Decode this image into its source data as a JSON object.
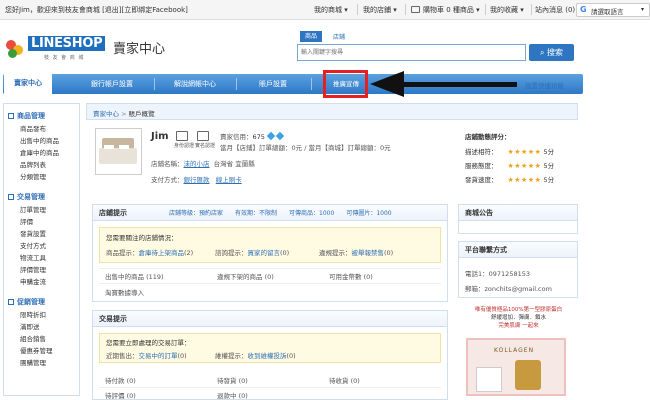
{
  "topbar": {
    "greeting": "您好Jim，歡迎來到枝友會商城",
    "logout": "[退出]",
    "bind_fb": "[立即綁定Facebook]",
    "my_mall": "我的商城",
    "my_store": "我的店鋪",
    "cart": "購物車 0 種商品",
    "favorites": "我的收藏",
    "site_msg": "站內消息 (0)",
    "translate": "請選取語言"
  },
  "brand": {
    "logo": "LINESHOP",
    "logo_sub": "枝 友 會 商 城",
    "page_title": "賣家中心",
    "accent": "#2f76c2"
  },
  "search": {
    "tab_products": "商品",
    "tab_stores": "店鋪",
    "placeholder": "輸入關鍵字搜尋",
    "button": "搜索"
  },
  "nav": {
    "items": [
      "賣家中心",
      "銀行帳戶設置",
      "解說網帳中心",
      "賬戶設置",
      "推廣宣傳"
    ],
    "shortcut": "設置快捷功能",
    "highlight_color": "#e52020"
  },
  "sidebar": {
    "groups": [
      {
        "title": "商品管理",
        "items": [
          "商品發布",
          "出售中的商品",
          "倉庫中的商品",
          "品牌列表",
          "分類管理"
        ]
      },
      {
        "title": "交易管理",
        "items": [
          "訂單管理",
          "評價",
          "發貨設置",
          "支付方式",
          "物流工具",
          "評價管理",
          "申購金流"
        ]
      },
      {
        "title": "促銷管理",
        "items": [
          "限時折扣",
          "滿即送",
          "組合銷售",
          "優惠券管理",
          "團購管理"
        ]
      }
    ]
  },
  "breadcrumb": {
    "home": "賣家中心",
    "sep": ">",
    "current": "賬戶概覽"
  },
  "profile": {
    "name": "Jim",
    "icon1": "身份認證",
    "icon2": "實名認證",
    "seller_credit_label": "賣家信用：",
    "seller_credit": "675",
    "month_label": "當月【店鋪】訂單總額：0元 / 當月【商城】訂單總額：0元",
    "store_label": "店鋪名稱：",
    "store_name": "沫的小店",
    "region": "台灣省 宜蘭縣",
    "pay_label": "支付方式：",
    "pay1": "銀行匯款",
    "pay2": "線上刷卡"
  },
  "ratings": {
    "title": "店鋪動態評分：",
    "rows": [
      {
        "label": "描述相符：",
        "stars": "★★★★★",
        "score": "5分"
      },
      {
        "label": "服務態度：",
        "stars": "★★★★★",
        "score": "5分"
      },
      {
        "label": "發貨速度：",
        "stars": "★★★★★",
        "score": "5分"
      }
    ]
  },
  "store_tips": {
    "title": "店鋪提示",
    "level": "店鋪等級：預約店家",
    "valid": "有效期：不限制",
    "products": "可傳商品：1000",
    "images": "可傳圖片：1000",
    "notice_title": "您需要關注的店鋪情況：",
    "product_tip_label": "商品提示：",
    "product_tip": "倉庫待上架商品",
    "product_tip_count": "(2)",
    "consult_label": "諮詢提示：",
    "consult": "買家的留言",
    "consult_count": "(0)",
    "violate_label": "違規提示：",
    "violate": "被舉報禁售",
    "violate_count": "(0)",
    "row1": [
      "出售中的商品 (119)",
      "違規下架的商品 (0)",
      "可用金幣數 (0)"
    ],
    "row2": "淘寶數據導入"
  },
  "trade_tips": {
    "title": "交易提示",
    "notice_title": "您需要立即處理的交易訂單：",
    "recent_label": "近期售出：",
    "recent": "交易中的訂單",
    "recent_count": "(0)",
    "refund_label": "維權提示：",
    "refund": "收到維權投訴",
    "refund_count": "(0)",
    "row1": [
      "待付款 (0)",
      "待發貨 (0)",
      "待收貨 (0)"
    ],
    "row2": [
      "待評價 (0)",
      "退款中 (0)"
    ]
  },
  "announce": {
    "title": "商城公告"
  },
  "contact": {
    "title": "平台聯繫方式",
    "phone_label": "電話1：",
    "phone": "0971258153",
    "email_label": "郵箱：",
    "email": "zonchits@gmail.com"
  },
  "ad": {
    "line1": "唯有優質極品100%第一型膠原蛋白",
    "line2": "舒緩增加．彈膚．鎖水",
    "line3": "完美肌膚 一起來",
    "brand": "KOLLAGEN"
  }
}
